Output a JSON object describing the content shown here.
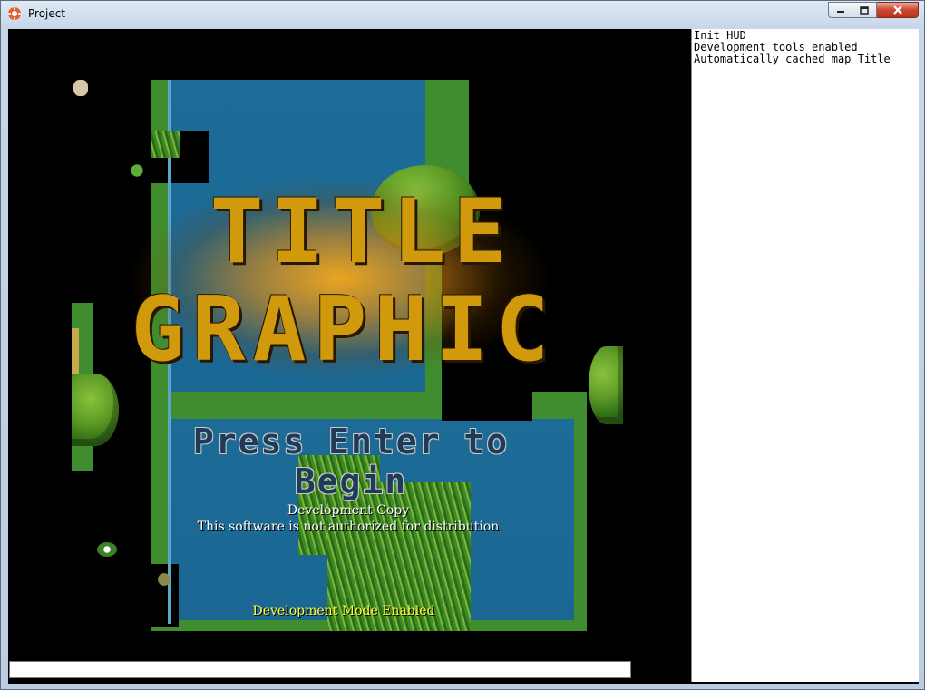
{
  "window": {
    "title": "Project",
    "icon": "orange-gear-icon",
    "controls": {
      "minimize": "minimize-icon",
      "maximize": "maximize-icon",
      "close": "close-icon"
    }
  },
  "game": {
    "title_line1": "TITLE",
    "title_line2": "GRAPHIC",
    "press_enter": "Press Enter to Begin",
    "dev_copy_line1": "Development Copy",
    "dev_copy_line2": "This software is not authorized for distribution",
    "dev_mode": "Development Mode Enabled",
    "colors": {
      "title": "#d19a0d",
      "title_glow": "#f6a81a",
      "water": "#1d6b97",
      "grass": "#3f8d2f",
      "dev_mode_text": "#ffff3a"
    }
  },
  "console": {
    "lines": [
      "Init HUD",
      "Development tools enabled",
      "Automatically cached map Title"
    ]
  },
  "command_input": {
    "value": ""
  }
}
